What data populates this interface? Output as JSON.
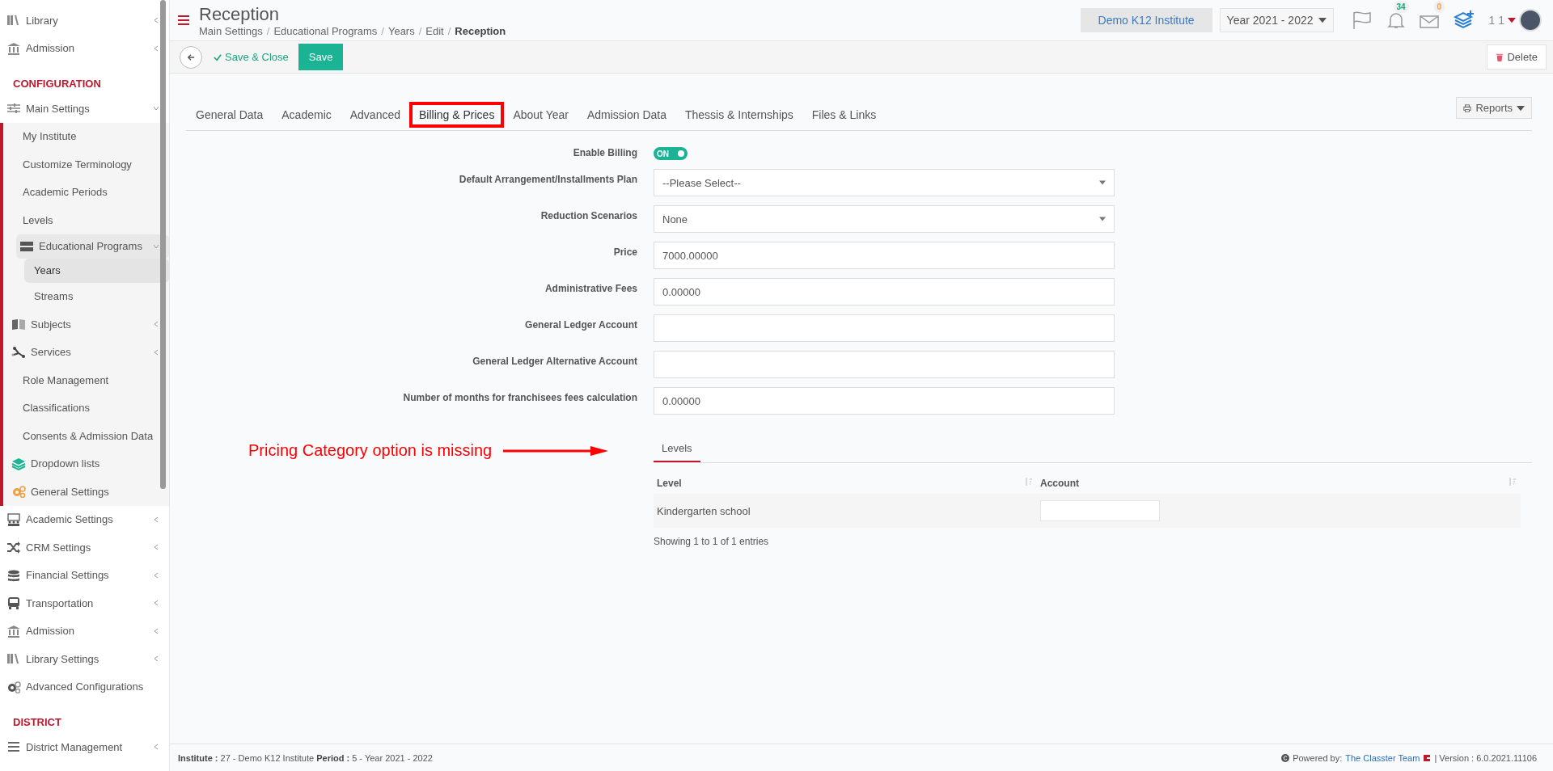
{
  "sidebar": {
    "items": [
      {
        "kind": "item",
        "label": "Library",
        "icon": true,
        "expanded": false
      },
      {
        "kind": "item",
        "label": "Admission",
        "icon": true,
        "expanded": false
      },
      {
        "kind": "section",
        "label": "CONFIGURATION"
      },
      {
        "kind": "item",
        "label": "Main Settings",
        "icon": true,
        "expanded": true,
        "children": [
          {
            "kind": "item",
            "label": "My Institute",
            "icon": false
          },
          {
            "kind": "item",
            "label": "Customize Terminology",
            "icon": false
          },
          {
            "kind": "item",
            "label": "Academic Periods",
            "icon": false
          },
          {
            "kind": "item",
            "label": "Levels",
            "icon": false
          },
          {
            "kind": "item",
            "label": "Educational Programs",
            "icon": true,
            "expanded": true,
            "children": [
              {
                "kind": "item",
                "label": "Years",
                "icon": false,
                "selected": true
              },
              {
                "kind": "item",
                "label": "Streams",
                "icon": false,
                "selected": false
              }
            ]
          },
          {
            "kind": "item",
            "label": "Subjects",
            "icon": true,
            "expanded": false
          },
          {
            "kind": "item",
            "label": "Services",
            "icon": true,
            "expanded": false
          },
          {
            "kind": "item",
            "label": "Role Management",
            "icon": false
          },
          {
            "kind": "item",
            "label": "Classifications",
            "icon": false
          },
          {
            "kind": "item",
            "label": "Consents & Admission Data",
            "icon": false
          },
          {
            "kind": "item",
            "label": "Dropdown lists",
            "icon": true
          },
          {
            "kind": "item",
            "label": "General Settings",
            "icon": true
          }
        ]
      },
      {
        "kind": "item",
        "label": "Academic Settings",
        "icon": true,
        "expanded": false
      },
      {
        "kind": "item",
        "label": "CRM Settings",
        "icon": true,
        "expanded": false
      },
      {
        "kind": "item",
        "label": "Financial Settings",
        "icon": true,
        "expanded": false
      },
      {
        "kind": "item",
        "label": "Transportation",
        "icon": true,
        "expanded": false
      },
      {
        "kind": "item",
        "label": "Admission",
        "icon": true,
        "expanded": false
      },
      {
        "kind": "item",
        "label": "Library Settings",
        "icon": true,
        "expanded": false
      },
      {
        "kind": "item",
        "label": "Advanced Configurations",
        "icon": true
      },
      {
        "kind": "section",
        "label": "DISTRICT"
      },
      {
        "kind": "item",
        "label": "District Management",
        "icon": true,
        "expanded": false
      }
    ]
  },
  "header": {
    "title": "Reception",
    "breadcrumbs": [
      {
        "label": "Main Settings",
        "current": false,
        "separator": "/"
      },
      {
        "label": "Educational Programs",
        "current": false,
        "separator": "/"
      },
      {
        "label": "Years",
        "current": false,
        "separator": "/"
      },
      {
        "label": "Edit",
        "current": false,
        "separator": "/"
      },
      {
        "label": "Reception",
        "current": true
      }
    ],
    "institute": "Demo K12 Institute",
    "year": "Year 2021 - 2022",
    "notifications": "34",
    "messages": "0",
    "user": "1 1"
  },
  "toolbar": {
    "save_close": "Save & Close",
    "save": "Save",
    "delete": "Delete"
  },
  "tabs": [
    {
      "label": "General Data",
      "selected": false
    },
    {
      "label": "Academic",
      "selected": false
    },
    {
      "label": "Advanced",
      "selected": false
    },
    {
      "label": "Billing & Prices",
      "selected": true
    },
    {
      "label": "About Year",
      "selected": false
    },
    {
      "label": "Admission Data",
      "selected": false
    },
    {
      "label": "Thessis & Internships",
      "selected": false
    },
    {
      "label": "Files & Links",
      "selected": false
    }
  ],
  "reports": "Reports",
  "fields": [
    {
      "kind": "toggle",
      "label": "Enable Billing",
      "on": true,
      "value": "ON"
    },
    {
      "kind": "select",
      "label": "Default Arrangement/Installments Plan",
      "value": "--Please Select--"
    },
    {
      "kind": "select",
      "label": "Reduction Scenarios",
      "value": "None"
    },
    {
      "kind": "input",
      "label": "Price",
      "value": "7000.00000"
    },
    {
      "kind": "input",
      "label": "Administrative Fees",
      "value": "0.00000"
    },
    {
      "kind": "input",
      "label": "General Ledger Account"
    },
    {
      "kind": "input",
      "label": "General Ledger Alternative Account"
    },
    {
      "kind": "input",
      "label": "Number of months for franchisees fees calculation",
      "value": "0.00000"
    }
  ],
  "annotation": "Pricing Category option is missing",
  "subtabs": [
    {
      "label": "Levels",
      "selected": true
    }
  ],
  "table": {
    "columns": [
      "Level",
      "Account"
    ],
    "rows": [
      {
        "level": "Kindergarten school"
      }
    ],
    "info": "Showing 1 to 1 of 1 entries"
  },
  "status_bar": {
    "left": "**Institute :** 27 - Demo K12 Institute **Period :** 5 - Year 2021 - 2022",
    "powered": "Powered by:",
    "team": "The Classter Team",
    "version": "| Version : 6.0.2021.11106"
  }
}
